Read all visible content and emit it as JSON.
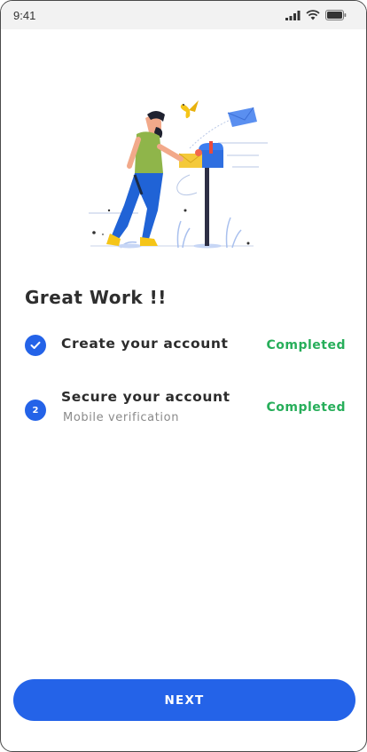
{
  "status_bar": {
    "time": "9:41"
  },
  "heading": "Great Work !!",
  "steps": [
    {
      "badge": "check-icon",
      "title": "Create your account",
      "subtitle": "",
      "status": "Completed"
    },
    {
      "badge": "2",
      "title": "Secure your account",
      "subtitle": "Mobile verification",
      "status": "Completed"
    }
  ],
  "next_button": {
    "label": "NEXT"
  },
  "colors": {
    "primary": "#2463e8",
    "success": "#27ae5a",
    "status_bar_bg": "#f2f2f2"
  },
  "icons": [
    "signal-icon",
    "wifi-icon",
    "battery-icon",
    "check-icon",
    "mailbox-illustration"
  ]
}
